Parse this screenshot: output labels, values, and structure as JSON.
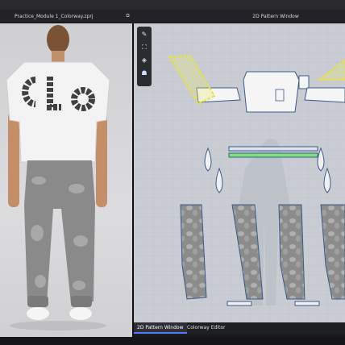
{
  "window": {
    "file_tab_title": "Practice_Module 1_Colorway.zprj",
    "pattern_window_title": "2D Pattern Window"
  },
  "toolbar2d": {
    "tools": [
      "pen-tool-icon",
      "shirt-icon",
      "fabric-icon",
      "avatar-icon"
    ]
  },
  "bottom_tabs": {
    "tab1": "2D Pattern Window",
    "tab2": "Colorway Editor"
  },
  "colors": {
    "accent": "#4a7cff",
    "pattern_line": "#3b5a8a",
    "green_line": "#7ee07e",
    "yellow_line": "#e8e040"
  }
}
